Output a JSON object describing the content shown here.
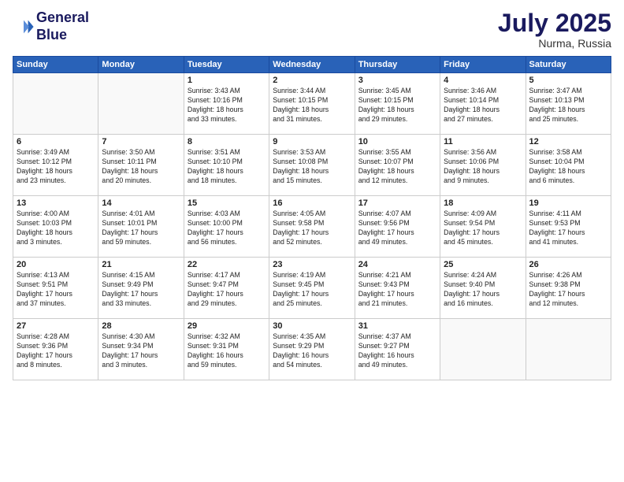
{
  "logo": {
    "line1": "General",
    "line2": "Blue"
  },
  "title": "July 2025",
  "location": "Nurma, Russia",
  "days_header": [
    "Sunday",
    "Monday",
    "Tuesday",
    "Wednesday",
    "Thursday",
    "Friday",
    "Saturday"
  ],
  "weeks": [
    [
      {
        "day": "",
        "info": ""
      },
      {
        "day": "",
        "info": ""
      },
      {
        "day": "1",
        "info": "Sunrise: 3:43 AM\nSunset: 10:16 PM\nDaylight: 18 hours\nand 33 minutes."
      },
      {
        "day": "2",
        "info": "Sunrise: 3:44 AM\nSunset: 10:15 PM\nDaylight: 18 hours\nand 31 minutes."
      },
      {
        "day": "3",
        "info": "Sunrise: 3:45 AM\nSunset: 10:15 PM\nDaylight: 18 hours\nand 29 minutes."
      },
      {
        "day": "4",
        "info": "Sunrise: 3:46 AM\nSunset: 10:14 PM\nDaylight: 18 hours\nand 27 minutes."
      },
      {
        "day": "5",
        "info": "Sunrise: 3:47 AM\nSunset: 10:13 PM\nDaylight: 18 hours\nand 25 minutes."
      }
    ],
    [
      {
        "day": "6",
        "info": "Sunrise: 3:49 AM\nSunset: 10:12 PM\nDaylight: 18 hours\nand 23 minutes."
      },
      {
        "day": "7",
        "info": "Sunrise: 3:50 AM\nSunset: 10:11 PM\nDaylight: 18 hours\nand 20 minutes."
      },
      {
        "day": "8",
        "info": "Sunrise: 3:51 AM\nSunset: 10:10 PM\nDaylight: 18 hours\nand 18 minutes."
      },
      {
        "day": "9",
        "info": "Sunrise: 3:53 AM\nSunset: 10:08 PM\nDaylight: 18 hours\nand 15 minutes."
      },
      {
        "day": "10",
        "info": "Sunrise: 3:55 AM\nSunset: 10:07 PM\nDaylight: 18 hours\nand 12 minutes."
      },
      {
        "day": "11",
        "info": "Sunrise: 3:56 AM\nSunset: 10:06 PM\nDaylight: 18 hours\nand 9 minutes."
      },
      {
        "day": "12",
        "info": "Sunrise: 3:58 AM\nSunset: 10:04 PM\nDaylight: 18 hours\nand 6 minutes."
      }
    ],
    [
      {
        "day": "13",
        "info": "Sunrise: 4:00 AM\nSunset: 10:03 PM\nDaylight: 18 hours\nand 3 minutes."
      },
      {
        "day": "14",
        "info": "Sunrise: 4:01 AM\nSunset: 10:01 PM\nDaylight: 17 hours\nand 59 minutes."
      },
      {
        "day": "15",
        "info": "Sunrise: 4:03 AM\nSunset: 10:00 PM\nDaylight: 17 hours\nand 56 minutes."
      },
      {
        "day": "16",
        "info": "Sunrise: 4:05 AM\nSunset: 9:58 PM\nDaylight: 17 hours\nand 52 minutes."
      },
      {
        "day": "17",
        "info": "Sunrise: 4:07 AM\nSunset: 9:56 PM\nDaylight: 17 hours\nand 49 minutes."
      },
      {
        "day": "18",
        "info": "Sunrise: 4:09 AM\nSunset: 9:54 PM\nDaylight: 17 hours\nand 45 minutes."
      },
      {
        "day": "19",
        "info": "Sunrise: 4:11 AM\nSunset: 9:53 PM\nDaylight: 17 hours\nand 41 minutes."
      }
    ],
    [
      {
        "day": "20",
        "info": "Sunrise: 4:13 AM\nSunset: 9:51 PM\nDaylight: 17 hours\nand 37 minutes."
      },
      {
        "day": "21",
        "info": "Sunrise: 4:15 AM\nSunset: 9:49 PM\nDaylight: 17 hours\nand 33 minutes."
      },
      {
        "day": "22",
        "info": "Sunrise: 4:17 AM\nSunset: 9:47 PM\nDaylight: 17 hours\nand 29 minutes."
      },
      {
        "day": "23",
        "info": "Sunrise: 4:19 AM\nSunset: 9:45 PM\nDaylight: 17 hours\nand 25 minutes."
      },
      {
        "day": "24",
        "info": "Sunrise: 4:21 AM\nSunset: 9:43 PM\nDaylight: 17 hours\nand 21 minutes."
      },
      {
        "day": "25",
        "info": "Sunrise: 4:24 AM\nSunset: 9:40 PM\nDaylight: 17 hours\nand 16 minutes."
      },
      {
        "day": "26",
        "info": "Sunrise: 4:26 AM\nSunset: 9:38 PM\nDaylight: 17 hours\nand 12 minutes."
      }
    ],
    [
      {
        "day": "27",
        "info": "Sunrise: 4:28 AM\nSunset: 9:36 PM\nDaylight: 17 hours\nand 8 minutes."
      },
      {
        "day": "28",
        "info": "Sunrise: 4:30 AM\nSunset: 9:34 PM\nDaylight: 17 hours\nand 3 minutes."
      },
      {
        "day": "29",
        "info": "Sunrise: 4:32 AM\nSunset: 9:31 PM\nDaylight: 16 hours\nand 59 minutes."
      },
      {
        "day": "30",
        "info": "Sunrise: 4:35 AM\nSunset: 9:29 PM\nDaylight: 16 hours\nand 54 minutes."
      },
      {
        "day": "31",
        "info": "Sunrise: 4:37 AM\nSunset: 9:27 PM\nDaylight: 16 hours\nand 49 minutes."
      },
      {
        "day": "",
        "info": ""
      },
      {
        "day": "",
        "info": ""
      }
    ]
  ]
}
